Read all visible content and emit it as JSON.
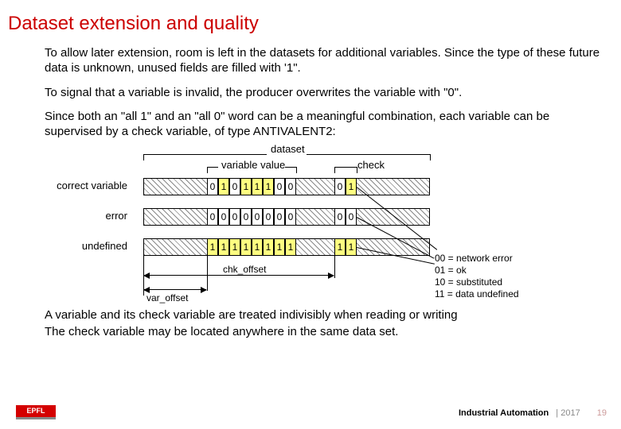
{
  "title": "Dataset extension and quality",
  "p1": "To allow later extension, room is left in the datasets for additional variables. Since the type of these future data is unknown, unused fields are filled with  '1\".",
  "p2": "To signal that a variable is invalid, the producer overwrites the variable with \"0\".",
  "p3": "Since both an \"all 1\" and an \"all 0\" word can be a meaningful combination, each variable can be supervised by a check variable, of type ANTIVALENT2:",
  "labels": {
    "dataset": "dataset",
    "variable_value": "variable value",
    "check": "check",
    "correct": "correct variable",
    "error": "error",
    "undefined": "undefined",
    "var_offset": "var_offset",
    "chk_offset": "chk_offset"
  },
  "rows": {
    "correct": {
      "value": [
        "0",
        "1",
        "0",
        "1",
        "1",
        "1",
        "0",
        "0"
      ],
      "check": [
        "0",
        "1"
      ]
    },
    "error": {
      "value": [
        "0",
        "0",
        "0",
        "0",
        "0",
        "0",
        "0",
        "0"
      ],
      "check": [
        "0",
        "0"
      ]
    },
    "undef": {
      "value": [
        "1",
        "1",
        "1",
        "1",
        "1",
        "1",
        "1",
        "1"
      ],
      "check": [
        "1",
        "1"
      ]
    }
  },
  "legend": {
    "l0": "00 = network error",
    "l1": "01 = ok",
    "l2": "10 = substituted",
    "l3": "11 = data undefined"
  },
  "footer1": "A variable and its check variable are treated indivisibly when reading or writing",
  "footer2": "The check variable may be located anywhere in the same data set.",
  "footR1": "Industrial Automation",
  "footR2": "| 2017",
  "footR3": "19",
  "logo": "EPFL"
}
